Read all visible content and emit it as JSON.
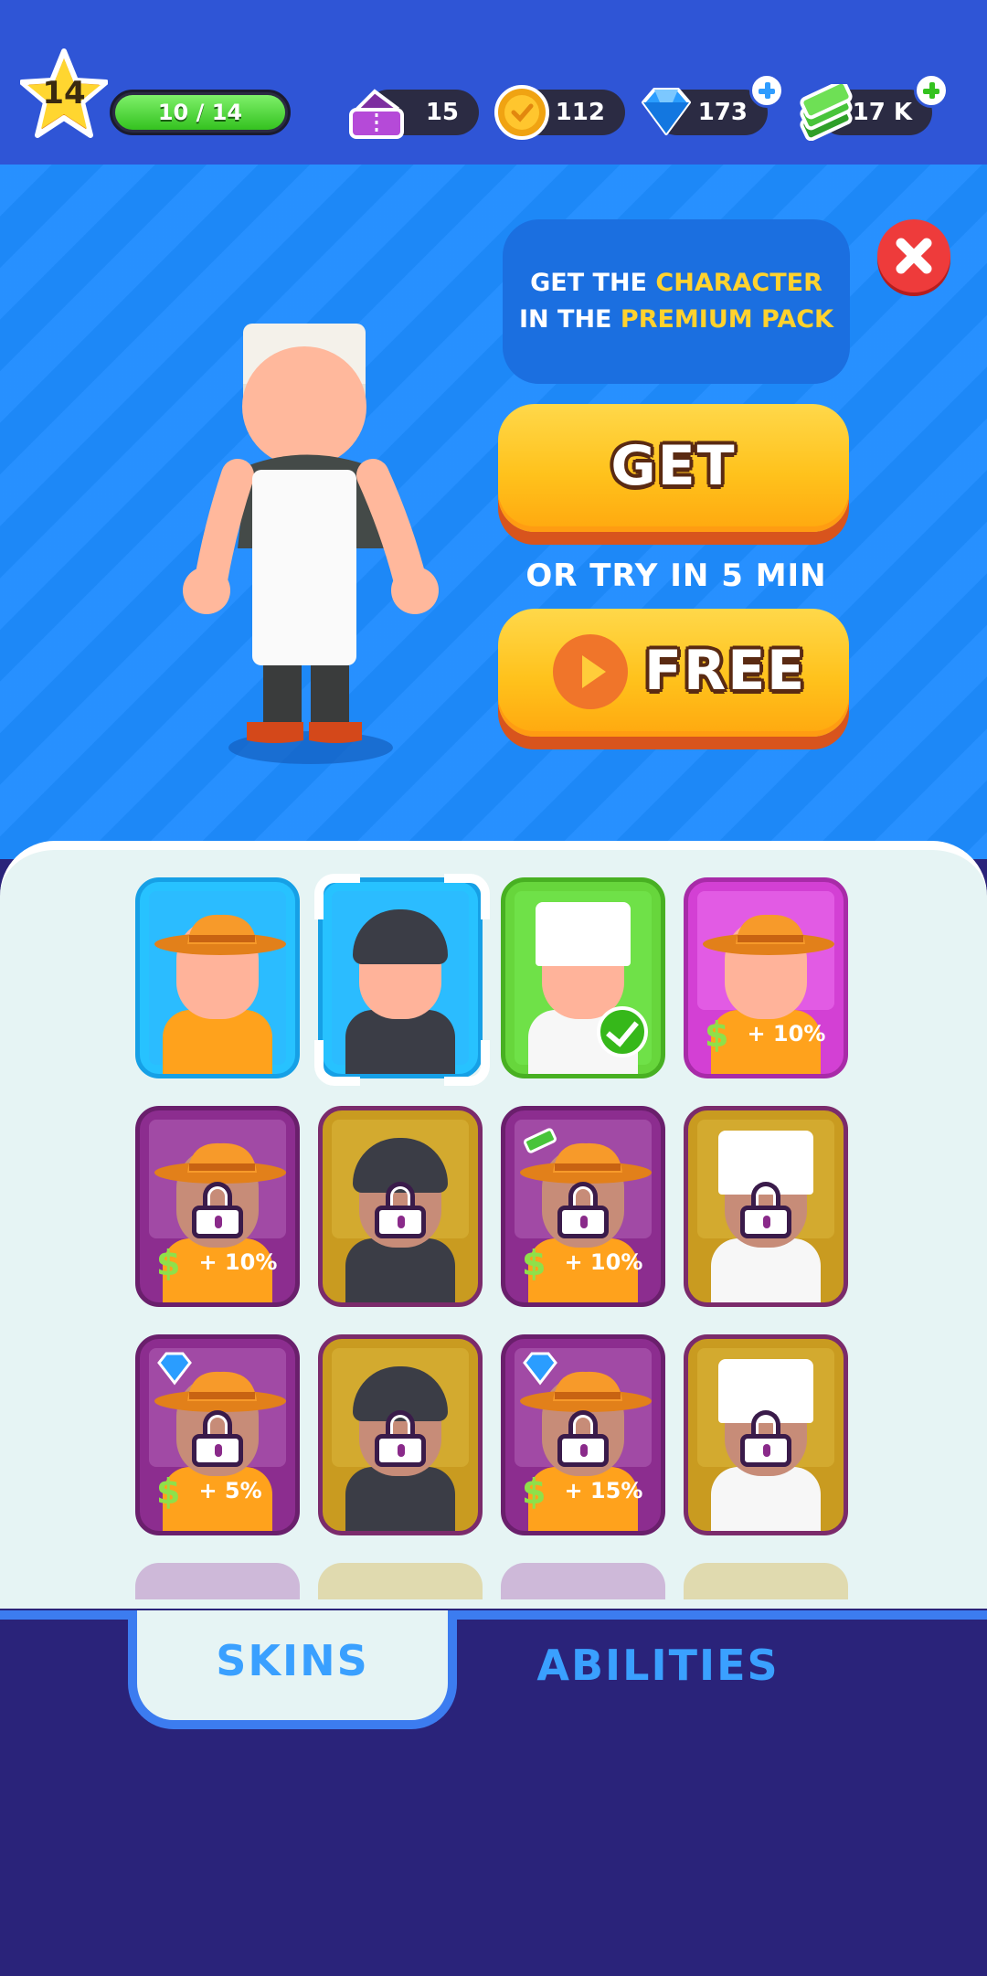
{
  "player": {
    "level": "14",
    "xp_text": "10 / 14",
    "xp_fraction": 1.0
  },
  "resources": {
    "tickets": "15",
    "coins": "112",
    "gems": "173",
    "cash": "17 K"
  },
  "offer": {
    "line1_prefix": "GET THE ",
    "line1_highlight": "CHARACTER",
    "line2_prefix": "IN THE ",
    "line2_highlight": "PREMIUM PACK",
    "get_label": "GET",
    "try_text": "OR TRY IN 5 MIN",
    "free_label": "FREE"
  },
  "skins": [
    {
      "type": "cowboy",
      "style": "blue",
      "state": "owned"
    },
    {
      "type": "soldier",
      "style": "blue",
      "state": "selected"
    },
    {
      "type": "chef",
      "style": "green",
      "state": "equipped"
    },
    {
      "type": "cowboy",
      "style": "magenta",
      "state": "owned",
      "perk": "+ 10%"
    },
    {
      "type": "cowboy",
      "style": "purple",
      "state": "locked",
      "perk": "+ 10%"
    },
    {
      "type": "soldier",
      "style": "gold",
      "state": "locked"
    },
    {
      "type": "cowboy",
      "style": "purple",
      "state": "locked",
      "perk": "+ 10%",
      "badge": "cash"
    },
    {
      "type": "chef",
      "style": "gold",
      "state": "locked"
    },
    {
      "type": "cowboy",
      "style": "purple",
      "state": "locked",
      "perk": "+ 5%",
      "badge": "gem"
    },
    {
      "type": "soldier",
      "style": "gold",
      "state": "locked"
    },
    {
      "type": "cowboy",
      "style": "purple",
      "state": "locked",
      "perk": "+ 15%",
      "badge": "gem"
    },
    {
      "type": "chef",
      "style": "gold",
      "state": "locked"
    }
  ],
  "skin_perk_icon": "$",
  "tabs": {
    "skins": "SKINS",
    "abilities": "ABILITIES"
  },
  "colors": {
    "accent_yellow": "#ffd22e",
    "close_red": "#ee3b3b",
    "tab_blue": "#3aa0ff"
  }
}
